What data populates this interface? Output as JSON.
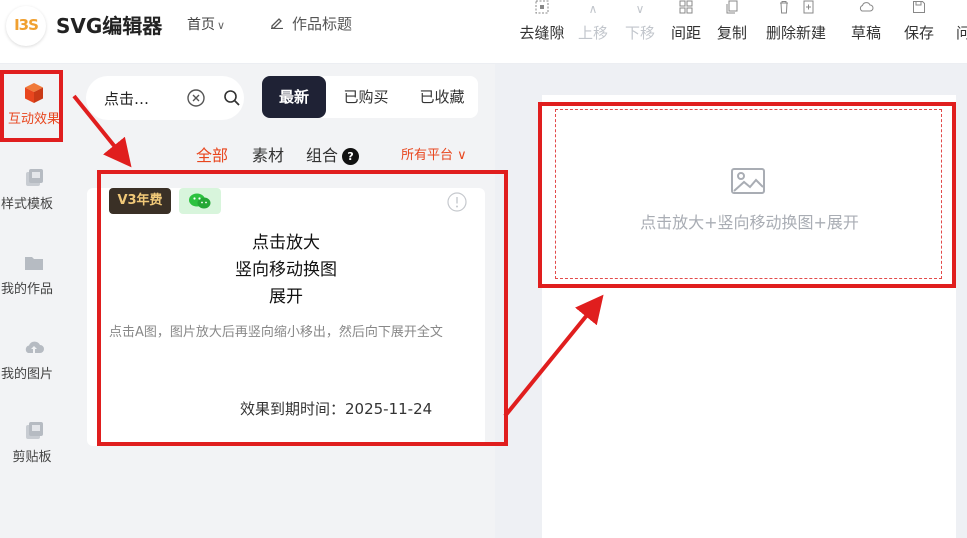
{
  "header": {
    "logo_text": "I3S",
    "app_title": "SVG编辑器",
    "home_menu": "首页",
    "work_title": "作品标题"
  },
  "toolbar": [
    {
      "label": "去缝隙",
      "icon": "gap-icon",
      "disabled": false
    },
    {
      "label": "上移",
      "icon": "arrow-up-icon",
      "disabled": true
    },
    {
      "label": "下移",
      "icon": "arrow-down-icon",
      "disabled": true
    },
    {
      "label": "间距",
      "icon": "spacing-icon",
      "disabled": false
    },
    {
      "label": "复制",
      "icon": "copy-icon",
      "disabled": false
    },
    {
      "label": "删除新建",
      "icon": "trash-icon",
      "disabled": false
    },
    {
      "label": "草稿",
      "icon": "cloud-icon",
      "disabled": false
    },
    {
      "label": "保存",
      "icon": "save-icon",
      "disabled": false
    },
    {
      "label": "问",
      "icon": "help-icon",
      "disabled": false
    }
  ],
  "sidebar": {
    "items": [
      {
        "label": "互动效果",
        "active": true
      },
      {
        "label": "样式模板",
        "active": false
      },
      {
        "label": "我的作品",
        "active": false
      },
      {
        "label": "我的图片",
        "active": false
      },
      {
        "label": "剪贴板",
        "active": false
      }
    ]
  },
  "search": {
    "value": "点击…"
  },
  "sort_tabs": [
    {
      "label": "最新",
      "active": true
    },
    {
      "label": "已购买",
      "active": false
    },
    {
      "label": "已收藏",
      "active": false
    }
  ],
  "category_tabs": [
    {
      "label": "全部",
      "active": true
    },
    {
      "label": "素材",
      "active": false
    },
    {
      "label": "组合",
      "active": false
    }
  ],
  "platform_filter": "所有平台",
  "card": {
    "badge_v3": "V3年费",
    "title_lines": [
      "点击放大",
      "竖向移动换图",
      "展开"
    ],
    "description": "点击A图，图片放大后再竖向缩小移出，然后向下展开全文",
    "expiry": "效果到期时间：2025-11-24"
  },
  "canvas": {
    "placeholder_text": "点击放大+竖向移动换图+展开"
  },
  "colors": {
    "accent": "#e8461e",
    "annotation": "#e01e1e",
    "dark_tab": "#1f2235"
  }
}
